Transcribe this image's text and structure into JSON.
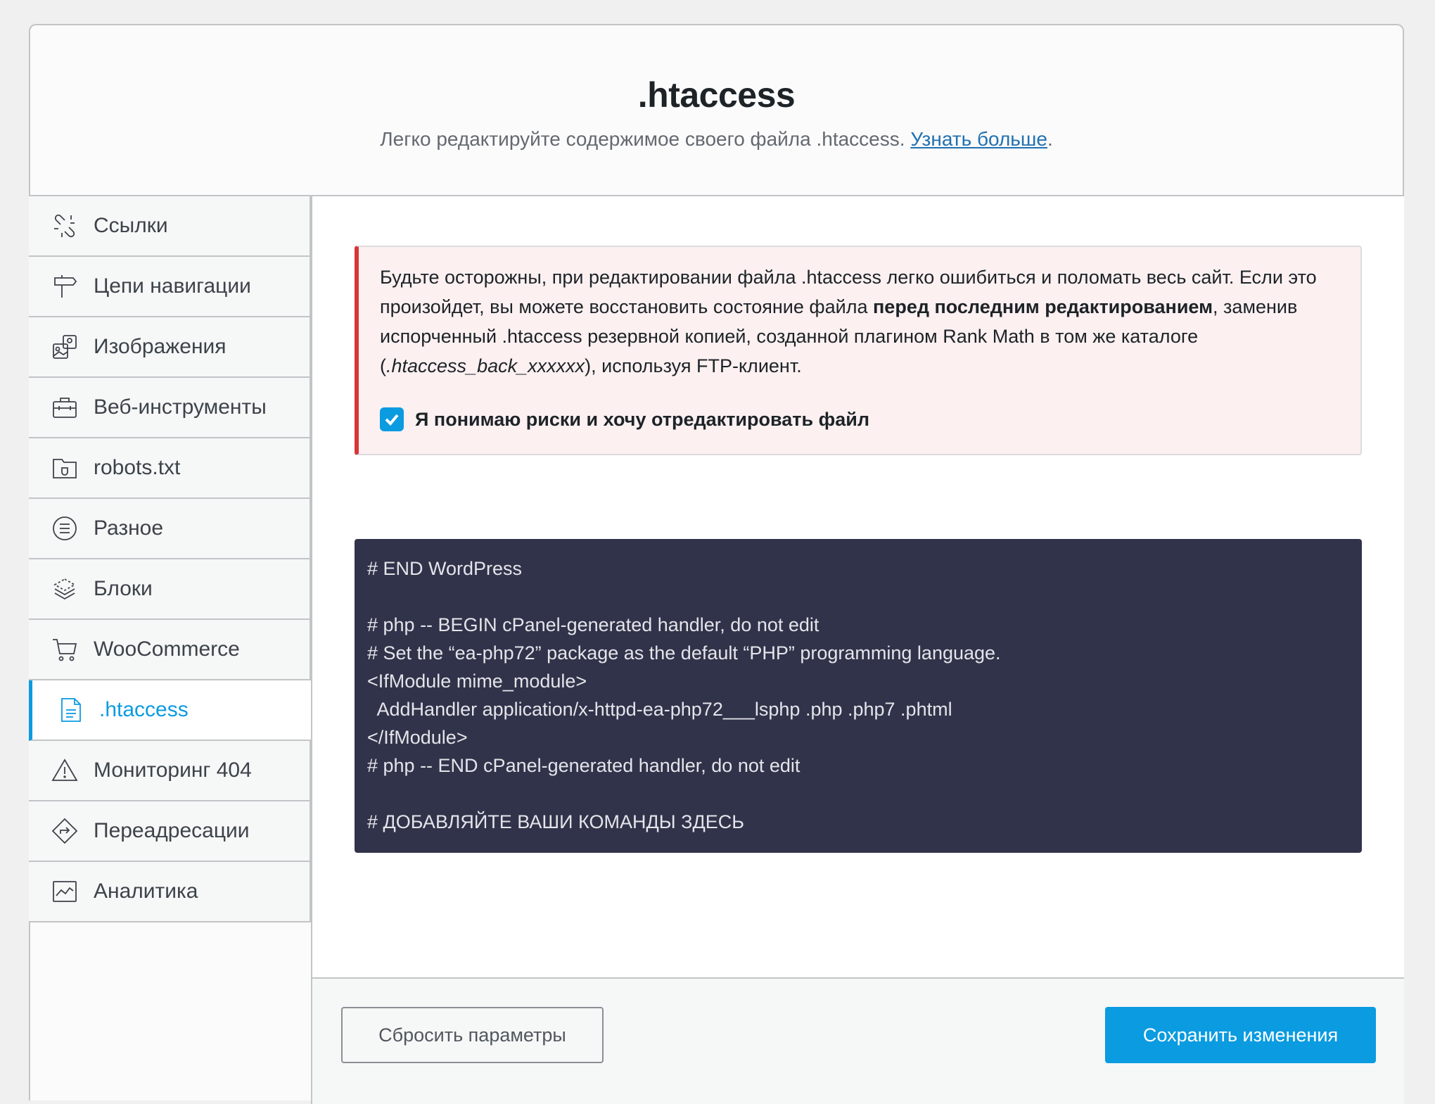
{
  "header": {
    "title": ".htaccess",
    "description": "Легко редактируйте содержимое своего файла .htaccess. ",
    "learn_more": "Узнать больше",
    "period": "."
  },
  "sidebar": {
    "items": [
      {
        "label": "Ссылки",
        "icon": "link-icon"
      },
      {
        "label": "Цепи навигации",
        "icon": "signpost-icon"
      },
      {
        "label": "Изображения",
        "icon": "images-icon"
      },
      {
        "label": "Веб-инструменты",
        "icon": "toolbox-icon"
      },
      {
        "label": "robots.txt",
        "icon": "folder-icon"
      },
      {
        "label": "Разное",
        "icon": "list-icon"
      },
      {
        "label": "Блоки",
        "icon": "blocks-icon"
      },
      {
        "label": "WooCommerce",
        "icon": "cart-icon"
      },
      {
        "label": ".htaccess",
        "icon": "file-icon",
        "active": true
      },
      {
        "label": "Мониторинг 404",
        "icon": "warning-icon"
      },
      {
        "label": "Переадресации",
        "icon": "redirect-icon"
      },
      {
        "label": "Аналитика",
        "icon": "analytics-icon"
      }
    ]
  },
  "notice": {
    "part1": "Будьте осторожны, при редактировании файла .htaccess легко ошибиться и поломать весь сайт. Если это произойдет, вы можете восстановить состояние файла ",
    "bold": "перед последним редактированием",
    "part2": ", заменив испорченный .htaccess резервной копией, созданной плагином Rank Math в том же каталоге (",
    "italic": ".htaccess_back_xxxxxx",
    "part3": "), используя FTP-клиент.",
    "checkbox_label": "Я понимаю риски и хочу отредактировать файл",
    "checkbox_checked": true
  },
  "code": {
    "content": "# END WordPress\n\n# php -- BEGIN cPanel-generated handler, do not edit\n# Set the “ea-php72” package as the default “PHP” programming language.\n<IfModule mime_module>\n  AddHandler application/x-httpd-ea-php72___lsphp .php .php7 .phtml\n</IfModule>\n# php -- END cPanel-generated handler, do not edit\n\n# ДОБАВЛЯЙТЕ ВАШИ КОМАНДЫ ЗДЕСЬ"
  },
  "footer": {
    "reset_label": "Сбросить параметры",
    "save_label": "Сохранить изменения"
  },
  "colors": {
    "accent": "#0b9be0",
    "danger": "#d63638",
    "code_bg": "#31334a"
  }
}
